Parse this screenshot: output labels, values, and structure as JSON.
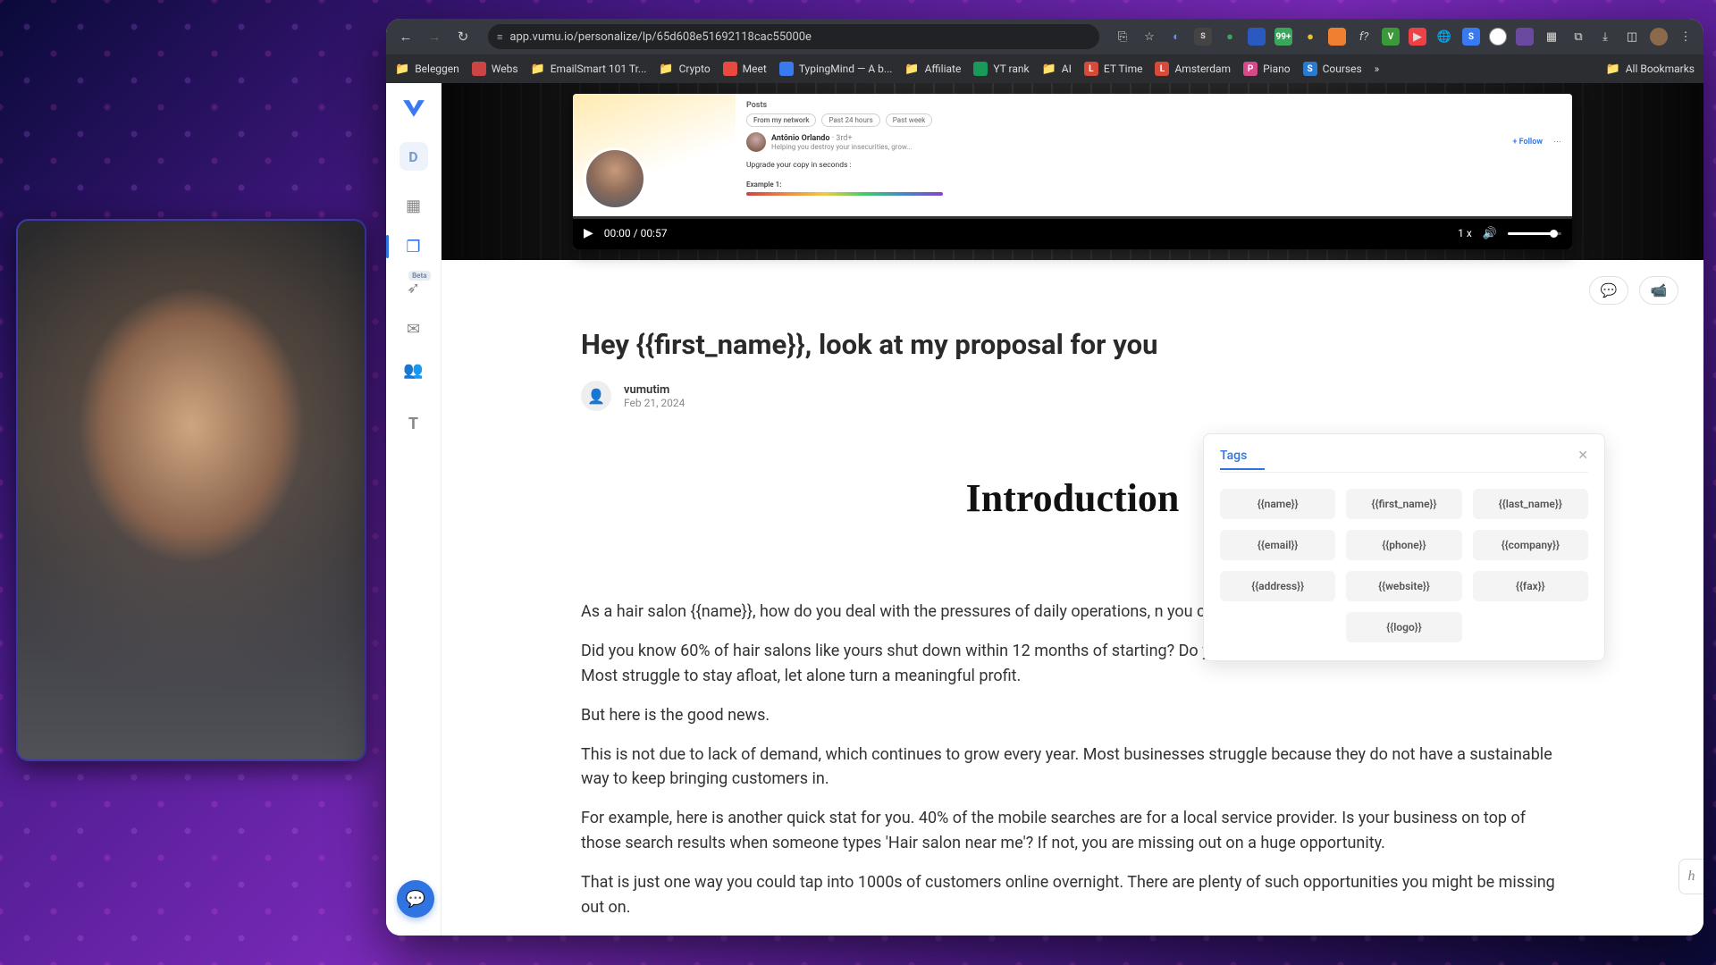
{
  "browser": {
    "url": "app.vumu.io/personalize/lp/65d608e51692118cac55000e",
    "bookmarks": [
      {
        "label": "Beleggen",
        "kind": "folder"
      },
      {
        "label": "Webs",
        "icon_bg": "#cc4444",
        "icon_text": ""
      },
      {
        "label": "EmailSmart 101 Tr...",
        "kind": "folder"
      },
      {
        "label": "Crypto",
        "kind": "folder"
      },
      {
        "label": "Meet",
        "icon_bg": "#e84a3f",
        "icon_text": ""
      },
      {
        "label": "TypingMind — A b...",
        "icon_bg": "#3a7af0",
        "icon_text": ""
      },
      {
        "label": "Affiliate",
        "kind": "folder"
      },
      {
        "label": "YT rank",
        "icon_bg": "#1a9a5a",
        "icon_text": ""
      },
      {
        "label": "AI",
        "kind": "folder"
      },
      {
        "label": "ET Time",
        "icon_bg": "#d64a3a",
        "icon_text": "L"
      },
      {
        "label": "Amsterdam",
        "icon_bg": "#d64a3a",
        "icon_text": "L"
      },
      {
        "label": "Piano",
        "icon_bg": "#d64a8a",
        "icon_text": "P"
      },
      {
        "label": "Courses",
        "icon_bg": "#2a7ad0",
        "icon_text": "S"
      }
    ],
    "all_bookmarks_label": "All Bookmarks"
  },
  "rail": {
    "d_letter": "D",
    "beta_badge": "Beta"
  },
  "video": {
    "posts_heading": "Posts",
    "chips": [
      "From my network",
      "Past 24 hours",
      "Past week"
    ],
    "post_author": "Antônio Orlando",
    "post_author_meta": "· 3rd+",
    "post_subtitle": "Helping you destroy your insecurities, grow...",
    "post_line": "Upgrade your copy in seconds :",
    "example": "Example 1:",
    "follow": "+ Follow",
    "time": "00:00 / 00:57",
    "speed": "1 x"
  },
  "page": {
    "heading": "Hey {{first_name}}, look at my proposal for you",
    "author_name": "vumutim",
    "author_date": "Feb 21, 2024",
    "intro_title": "Introduction",
    "paragraphs": [
      "As a hair salon {{name}}, how do you deal with the pressures of daily operations, n you continue to do your best work?",
      "Did you know 60% of hair salons like yours shut down within 12 months of starting? Do you know what happens to the ones that survive? Most struggle to stay afloat, let alone turn a meaningful profit.",
      "But here is the good news.",
      "This is not due to lack of demand, which continues to grow every year. Most businesses struggle because they do not have a sustainable way to keep bringing customers in.",
      "For example, here is another quick stat for you. 40% of the mobile searches are for a local service provider. Is your business on top of those search results when someone types 'Hair salon near me'? If not, you are missing out on a huge opportunity.",
      "That is just one way you could tap into 1000s of customers online overnight. There are plenty of such opportunities you might be missing out on."
    ]
  },
  "tags": {
    "title": "Tags",
    "items": [
      "{{name}}",
      "{{first_name}}",
      "{{last_name}}",
      "{{email}}",
      "{{phone}}",
      "{{company}}",
      "{{address}}",
      "{{website}}",
      "{{fax}}",
      "{{logo}}"
    ]
  }
}
